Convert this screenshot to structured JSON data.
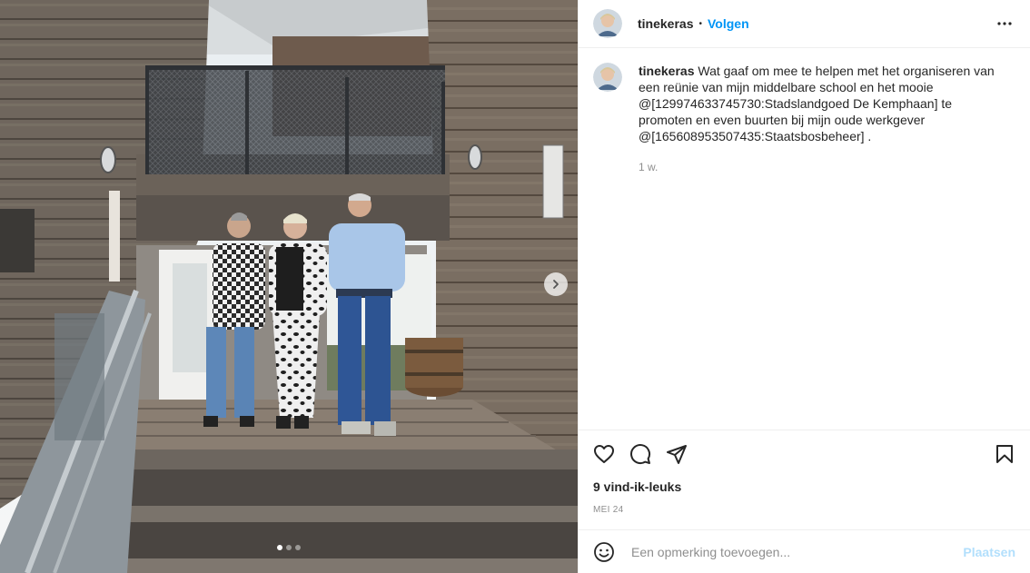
{
  "post": {
    "username": "tinekeras",
    "separator": "•",
    "follow_label": "Volgen",
    "caption_username": "tinekeras",
    "caption_text": "Wat gaaf om mee te helpen met het organiseren van een reünie van mijn middelbare school en het mooie @[129974633745730:Stadslandgoed De Kemphaan] te promoten en even buurten bij mijn oude werkgever @[165608953507435:Staatsbosbeheer] .",
    "age": "1 w.",
    "likes": "9 vind-ik-leuks",
    "date": "MEI 24"
  },
  "carousel": {
    "current": 1,
    "total": 3
  },
  "comment": {
    "placeholder": "Een opmerking toevoegen...",
    "submit_label": "Plaatsen"
  },
  "icons": {
    "more": "more-options-icon",
    "like": "heart-icon",
    "comment": "comment-icon",
    "share": "send-icon",
    "save": "bookmark-icon",
    "emoji": "emoji-icon",
    "next": "chevron-right-icon"
  },
  "colors": {
    "accent": "#0095f6",
    "submit_disabled": "#b2dffc",
    "muted": "#8e8e8e",
    "text": "#262626"
  }
}
